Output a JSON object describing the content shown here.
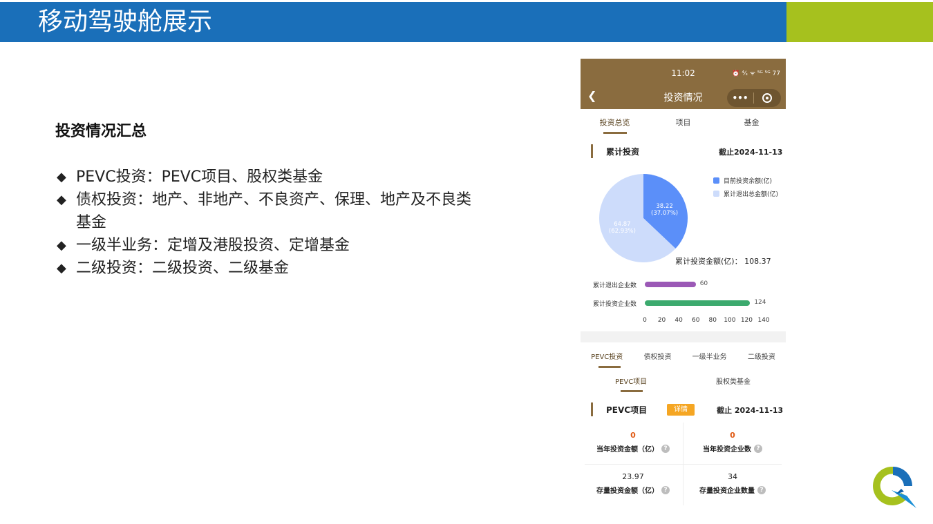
{
  "slide": {
    "title": "移动驾驶舱展示",
    "section_title": "投资情况汇总",
    "bullets": [
      {
        "marker": "◆",
        "text": "PEVC投资：PEVC项目、股权类基金"
      },
      {
        "marker": "◆",
        "text": "债权投资：地产、非地产、不良资产、保理、地产及不良类基金"
      },
      {
        "marker": "◆",
        "text": "一级半业务：定增及港股投资、定增基金"
      },
      {
        "marker": "◆",
        "text": "二级投资：二级投资、二级基金"
      }
    ],
    "colors": {
      "title_bar": "#1a6fb9",
      "accent": "#a6c11e"
    }
  },
  "phone": {
    "status_time": "11:02",
    "status_icons": "⏰ ⁴⁄ₛ ᯤ ⁵ᴳ ⁵ᴳ 77",
    "back_icon": "chevron-left-icon",
    "header_title": "投资情况",
    "capsule_more": "•••",
    "tabs_top": [
      "投资总览",
      "项目",
      "基金"
    ],
    "cumulative": {
      "label": "累计投资",
      "date": "截止2024-11-13",
      "total_label": "累计投资金额(亿)：",
      "total_value": "108.37"
    },
    "bars": [
      {
        "label": "累计退出企业数",
        "value": 60,
        "color": "#9b59b6",
        "value_text": "60"
      },
      {
        "label": "累计投资企业数",
        "value": 124,
        "color": "#3caa6e",
        "value_text": "124"
      }
    ],
    "bar_axis": {
      "max": 140,
      "ticks": [
        "0",
        "20",
        "40",
        "60",
        "80",
        "100",
        "120",
        "140"
      ]
    },
    "tabs2": [
      "PEVC投资",
      "债权投资",
      "一级半业务",
      "二级投资"
    ],
    "tabs3": [
      "PEVC项目",
      "股权类基金"
    ],
    "pevc": {
      "label": "PEVC项目",
      "detail_badge": "详情",
      "date": "截止 2024-11-13",
      "stats": [
        {
          "value": "0",
          "label": "当年投资金额（亿）",
          "highlight": true
        },
        {
          "value": "0",
          "label": "当年投资企业数",
          "highlight": true
        },
        {
          "value": "23.97",
          "label": "存量投资金额（亿）",
          "highlight": false
        },
        {
          "value": "34",
          "label": "存量投资企业数量",
          "highlight": false
        }
      ],
      "help_icon": "?"
    }
  },
  "chart_data": {
    "type": "pie",
    "series": [
      {
        "name": "目前投资余额(亿)",
        "value": 38.22,
        "percent": "37.07%",
        "label": "38.22",
        "pct_label": "(37.07%)",
        "color": "#5b8ff9"
      },
      {
        "name": "累计退出总金额(亿)",
        "value": 64.87,
        "percent": "62.93%",
        "label": "64.87",
        "pct_label": "(62.93%)",
        "color": "#cddcfb"
      }
    ],
    "legend_position": "top-right"
  }
}
